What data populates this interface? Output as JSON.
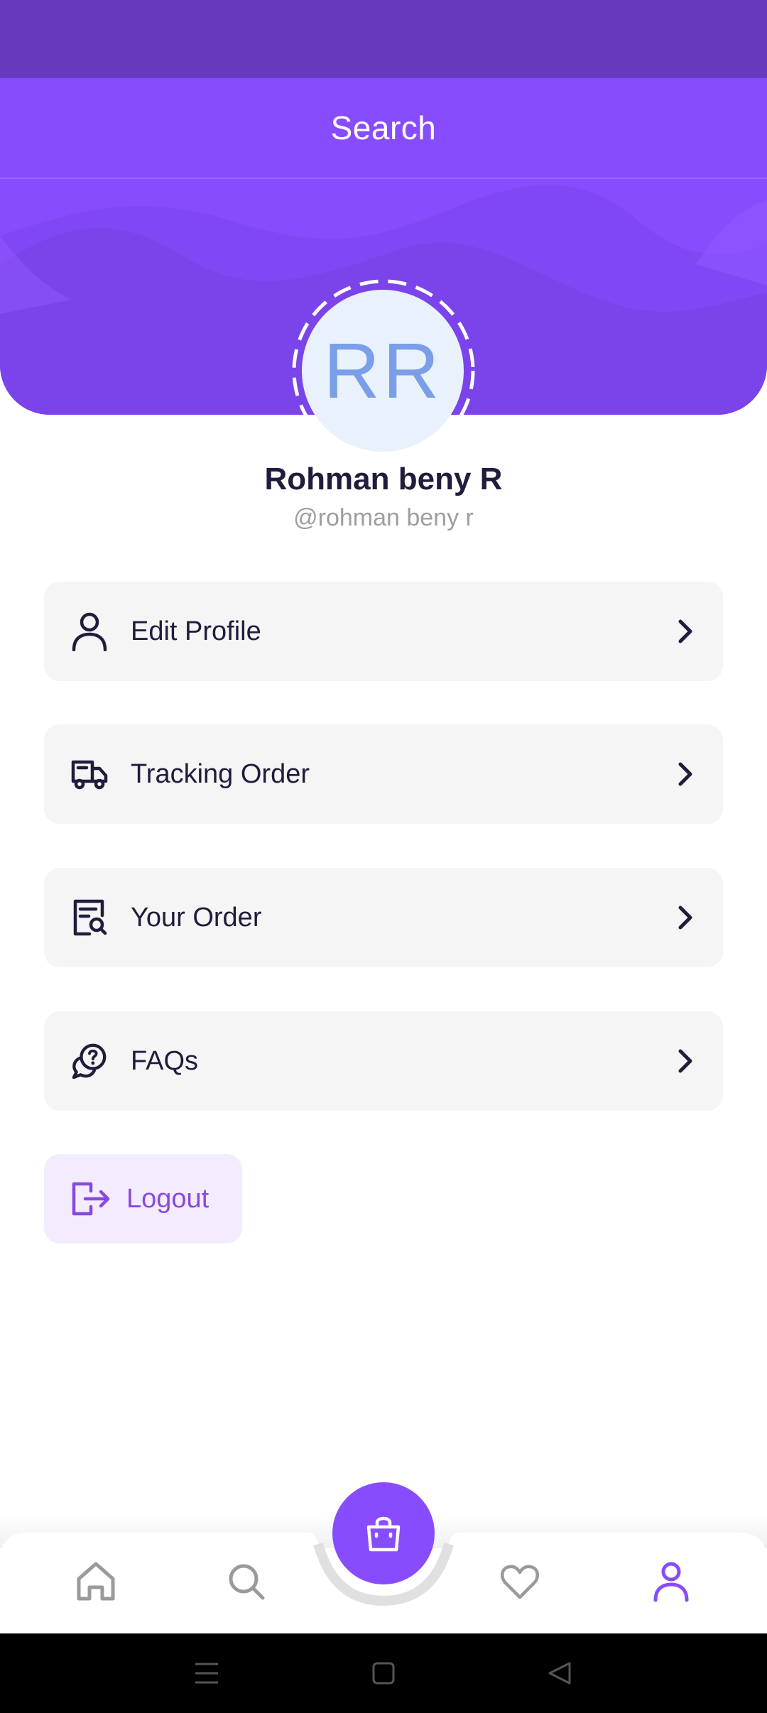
{
  "app_bar": {
    "title": "Search"
  },
  "profile": {
    "initials": "RR",
    "name": "Rohman beny R",
    "handle": "@rohman beny r"
  },
  "menu": [
    {
      "label": "Edit Profile",
      "icon": "user-icon"
    },
    {
      "label": "Tracking Order",
      "icon": "truck-icon"
    },
    {
      "label": "Your Order",
      "icon": "receipt-search-icon"
    },
    {
      "label": "FAQs",
      "icon": "faq-chat-icon"
    }
  ],
  "logout": {
    "label": "Logout",
    "icon": "logout-icon"
  },
  "bottom_nav": {
    "items": [
      "home-icon",
      "search-icon",
      "shopping-bag-icon",
      "heart-icon",
      "profile-icon"
    ],
    "active": "profile-icon"
  },
  "colors": {
    "primary": "#884cff",
    "status_bar": "#6639bd",
    "text_dark": "#1f1d3b",
    "text_muted": "#9e9e9e",
    "menu_bg": "#f5f5f5",
    "logout_bg": "#f3ecfe",
    "logout_text": "#8a48e0",
    "inactive_icon": "#9a9a9a"
  }
}
